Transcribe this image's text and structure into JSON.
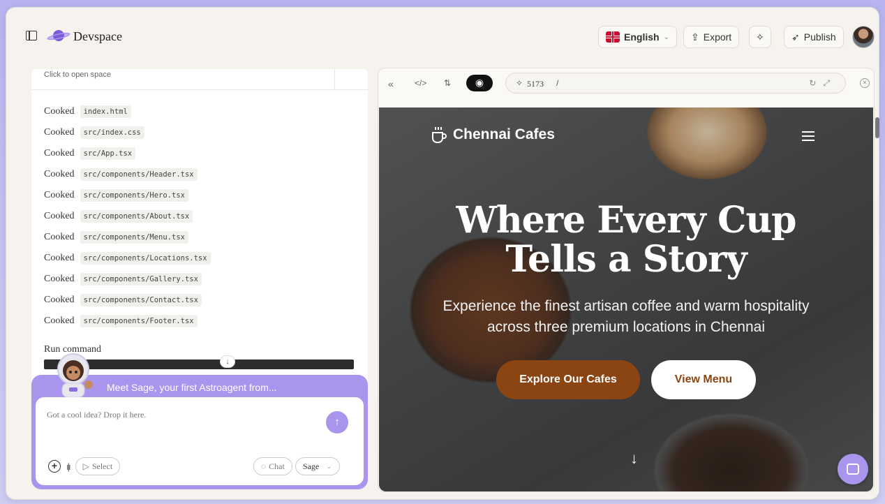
{
  "app": {
    "name": "Devspace"
  },
  "header": {
    "language": "English",
    "export_label": "Export",
    "publish_label": "Publish"
  },
  "left": {
    "space_hint": "Click to open space",
    "log": [
      {
        "verb": "Cooked",
        "file": "index.html"
      },
      {
        "verb": "Cooked",
        "file": "src/index.css"
      },
      {
        "verb": "Cooked",
        "file": "src/App.tsx"
      },
      {
        "verb": "Cooked",
        "file": "src/components/Header.tsx"
      },
      {
        "verb": "Cooked",
        "file": "src/components/Hero.tsx"
      },
      {
        "verb": "Cooked",
        "file": "src/components/About.tsx"
      },
      {
        "verb": "Cooked",
        "file": "src/components/Menu.tsx"
      },
      {
        "verb": "Cooked",
        "file": "src/components/Locations.tsx"
      },
      {
        "verb": "Cooked",
        "file": "src/components/Gallery.tsx"
      },
      {
        "verb": "Cooked",
        "file": "src/components/Contact.tsx"
      },
      {
        "verb": "Cooked",
        "file": "src/components/Footer.tsx"
      }
    ],
    "run_command": "Run command"
  },
  "chat": {
    "meet_text": "Meet Sage, your first Astroagent from...",
    "placeholder": "Got a cool idea? Drop it here.",
    "select_label": "Select",
    "chat_label": "Chat",
    "agent_label": "Sage"
  },
  "preview": {
    "port": "5173",
    "path": "/",
    "site": {
      "brand": "Chennai Cafes",
      "hero_title_line1": "Where Every Cup",
      "hero_title_line2": "Tells a Story",
      "hero_sub_line1": "Experience the finest artisan coffee and warm hospitality",
      "hero_sub_line2": "across three premium locations in Chennai",
      "cta_primary": "Explore Our Cafes",
      "cta_secondary": "View Menu"
    }
  },
  "colors": {
    "accent": "#a995ee",
    "brand_brown": "#8b4513",
    "background": "#f6f3ef"
  }
}
